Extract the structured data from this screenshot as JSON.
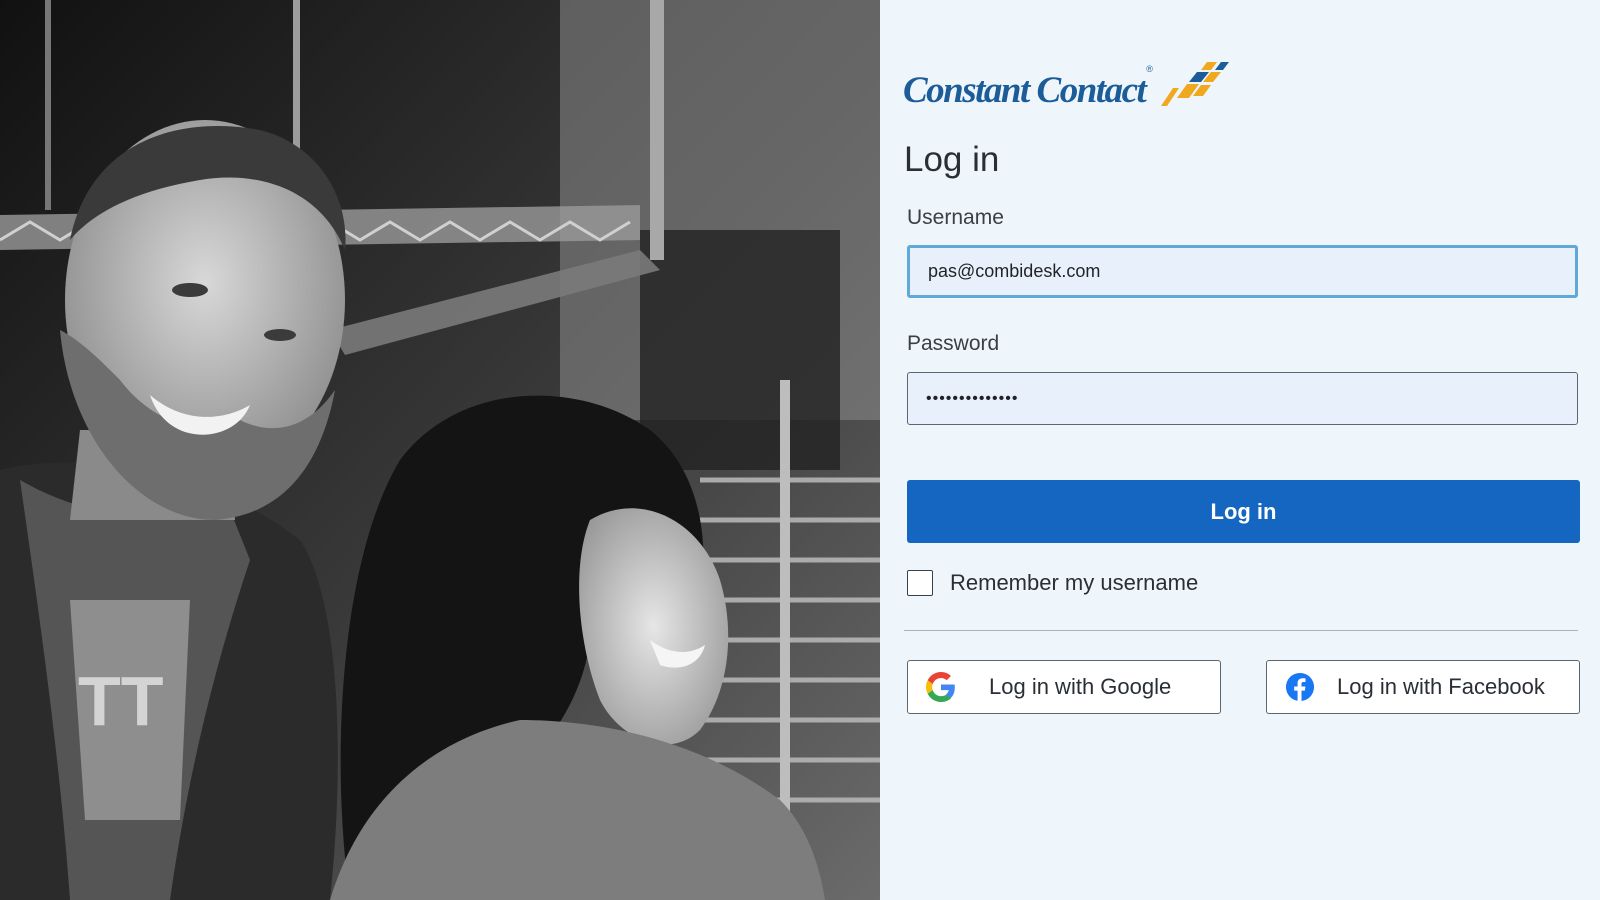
{
  "brand": {
    "name": "Constant Contact",
    "registered_mark": "®",
    "logo_mark": "constant-contact-logo-mark",
    "colors": {
      "logo_blue": "#1b5c99",
      "logo_gold": "#f0a81e",
      "panel_background": "#eef6fc",
      "primary_button": "#1566c0"
    }
  },
  "hero_image": {
    "icon": "photo-smiling-couple"
  },
  "login_form": {
    "title": "Log in",
    "username": {
      "label": "Username",
      "value": "pas@combidesk.com"
    },
    "password": {
      "label": "Password",
      "value": "••••••••••••••"
    },
    "submit_label": "Log in",
    "remember_label": "Remember my username",
    "remember_checked": false
  },
  "social_login": {
    "google": {
      "label": "Log in with Google",
      "icon": "google-icon"
    },
    "facebook": {
      "label": "Log in with Facebook",
      "icon": "facebook-icon",
      "color": "#1877f2"
    }
  }
}
